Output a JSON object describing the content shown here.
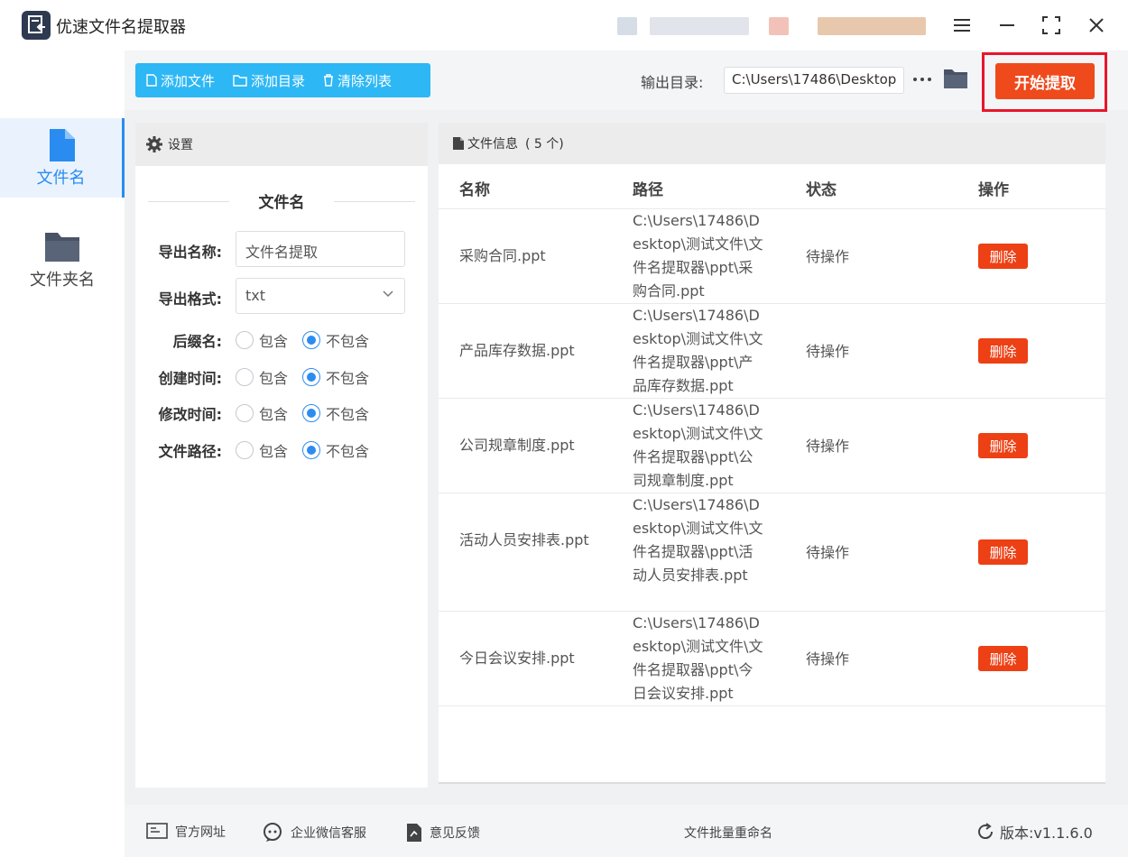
{
  "app": {
    "title": "优速文件名提取器",
    "accent": "#2a8cf0",
    "primary_action_color": "#ef4a1c",
    "danger_color": "#ed4014"
  },
  "window_controls": [
    "menu-icon",
    "minimize-icon",
    "maximize-icon",
    "close-icon"
  ],
  "sidebar": {
    "items": [
      {
        "label": "文件名",
        "icon": "file-icon",
        "active": true
      },
      {
        "label": "文件夹名",
        "icon": "folder-icon",
        "active": false
      }
    ]
  },
  "toolbar": {
    "add_file": "添加文件",
    "add_dir": "添加目录",
    "clear_list": "清除列表",
    "output_label": "输出目录:",
    "output_value": "C:\\Users\\17486\\Desktop",
    "start_label": "开始提取"
  },
  "settings": {
    "header": "设置",
    "section_title": "文件名",
    "export_name_label": "导出名称:",
    "export_name_value": "文件名提取",
    "export_format_label": "导出格式:",
    "export_format_value": "txt",
    "include_label": "包含",
    "exclude_label": "不包含",
    "options": [
      {
        "label": "后缀名:",
        "selected": "exclude"
      },
      {
        "label": "创建时间:",
        "selected": "exclude"
      },
      {
        "label": "修改时间:",
        "selected": "exclude"
      },
      {
        "label": "文件路径:",
        "selected": "exclude"
      }
    ]
  },
  "files": {
    "header": "文件信息",
    "count_text": "( 5 个)",
    "columns": [
      "名称",
      "路径",
      "状态",
      "操作"
    ],
    "delete_label": "删除",
    "rows": [
      {
        "name": "采购合同.ppt",
        "path": "C:\\Users\\17486\\Desktop\\测试文件\\文件名提取器\\ppt\\采购合同.ppt",
        "status": "待操作"
      },
      {
        "name": "产品库存数据.ppt",
        "path": "C:\\Users\\17486\\Desktop\\测试文件\\文件名提取器\\ppt\\产品库存数据.ppt",
        "status": "待操作"
      },
      {
        "name": "公司规章制度.ppt",
        "path": "C:\\Users\\17486\\Desktop\\测试文件\\文件名提取器\\ppt\\公司规章制度.ppt",
        "status": "待操作"
      },
      {
        "name": "活动人员安排表.ppt",
        "path": "C:\\Users\\17486\\Desktop\\测试文件\\文件名提取器\\ppt\\活动人员安排表.ppt",
        "status": "待操作"
      },
      {
        "name": "今日会议安排.ppt",
        "path": "C:\\Users\\17486\\Desktop\\测试文件\\文件名提取器\\ppt\\今日会议安排.ppt",
        "status": "待操作"
      }
    ]
  },
  "footer": {
    "website": "官方网址",
    "wechat": "企业微信客服",
    "feedback": "意见反馈",
    "center": "文件批量重命名",
    "version": "版本:v1.1.6.0"
  }
}
